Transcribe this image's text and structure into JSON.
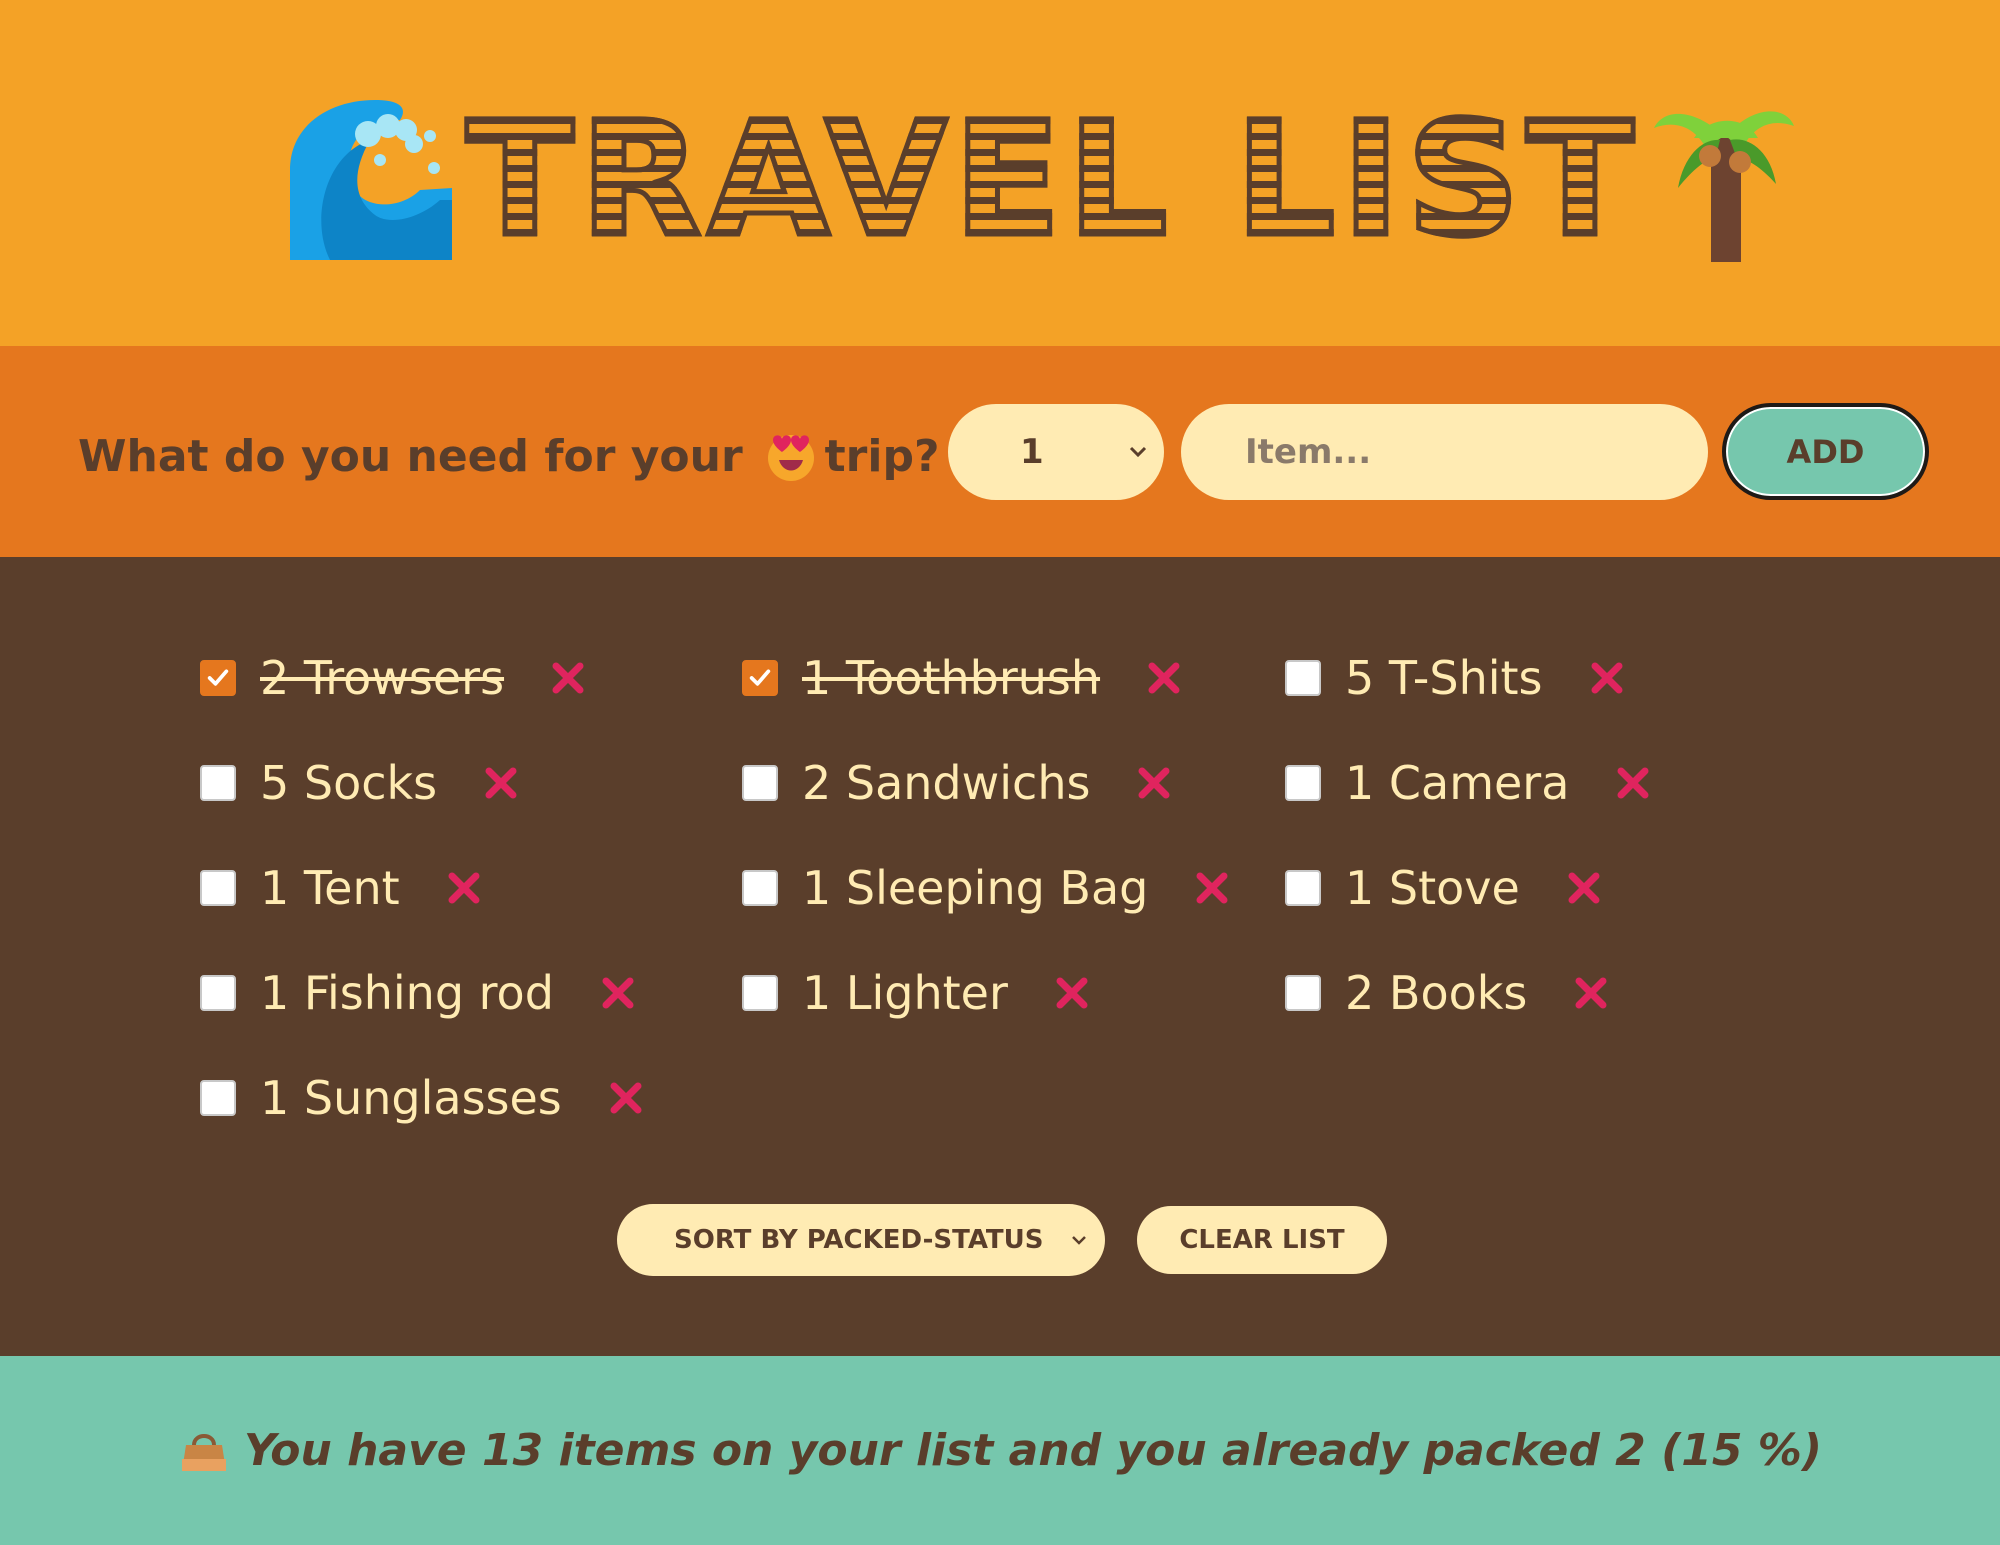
{
  "header": {
    "title": "TRAVEL LIST",
    "left_icon": "wave-icon",
    "right_icon": "palm-tree-icon"
  },
  "form": {
    "question_before": "What do you need for your",
    "question_emoji": "heart-eyes-icon",
    "question_after": "trip?",
    "quantity_value": "1",
    "item_placeholder": "Item...",
    "add_label": "ADD"
  },
  "items": [
    {
      "label": "2 Trowsers",
      "packed": true
    },
    {
      "label": "1 Toothbrush",
      "packed": true
    },
    {
      "label": "5 T-Shits",
      "packed": false
    },
    {
      "label": "5 Socks",
      "packed": false
    },
    {
      "label": "2 Sandwichs",
      "packed": false
    },
    {
      "label": "1 Camera",
      "packed": false
    },
    {
      "label": "1 Tent",
      "packed": false
    },
    {
      "label": "1 Sleeping Bag",
      "packed": false
    },
    {
      "label": "1 Stove",
      "packed": false
    },
    {
      "label": "1 Fishing rod",
      "packed": false
    },
    {
      "label": "1 Lighter",
      "packed": false
    },
    {
      "label": "2 Books",
      "packed": false
    },
    {
      "label": "1 Sunglasses",
      "packed": false
    }
  ],
  "actions": {
    "sort_value": "SORT BY PACKED-STATUS",
    "clear_label": "CLEAR LIST"
  },
  "stats": {
    "icon": "handbag-icon",
    "text": "You have 13 items on your list and you already packed 2 (15 %)"
  },
  "colors": {
    "header_bg": "#f4a226",
    "form_bg": "#e5771e",
    "list_bg": "#5a3e2b",
    "stats_bg": "#76c7ad",
    "cream": "#ffebb3",
    "delete_red": "#e0245e"
  }
}
